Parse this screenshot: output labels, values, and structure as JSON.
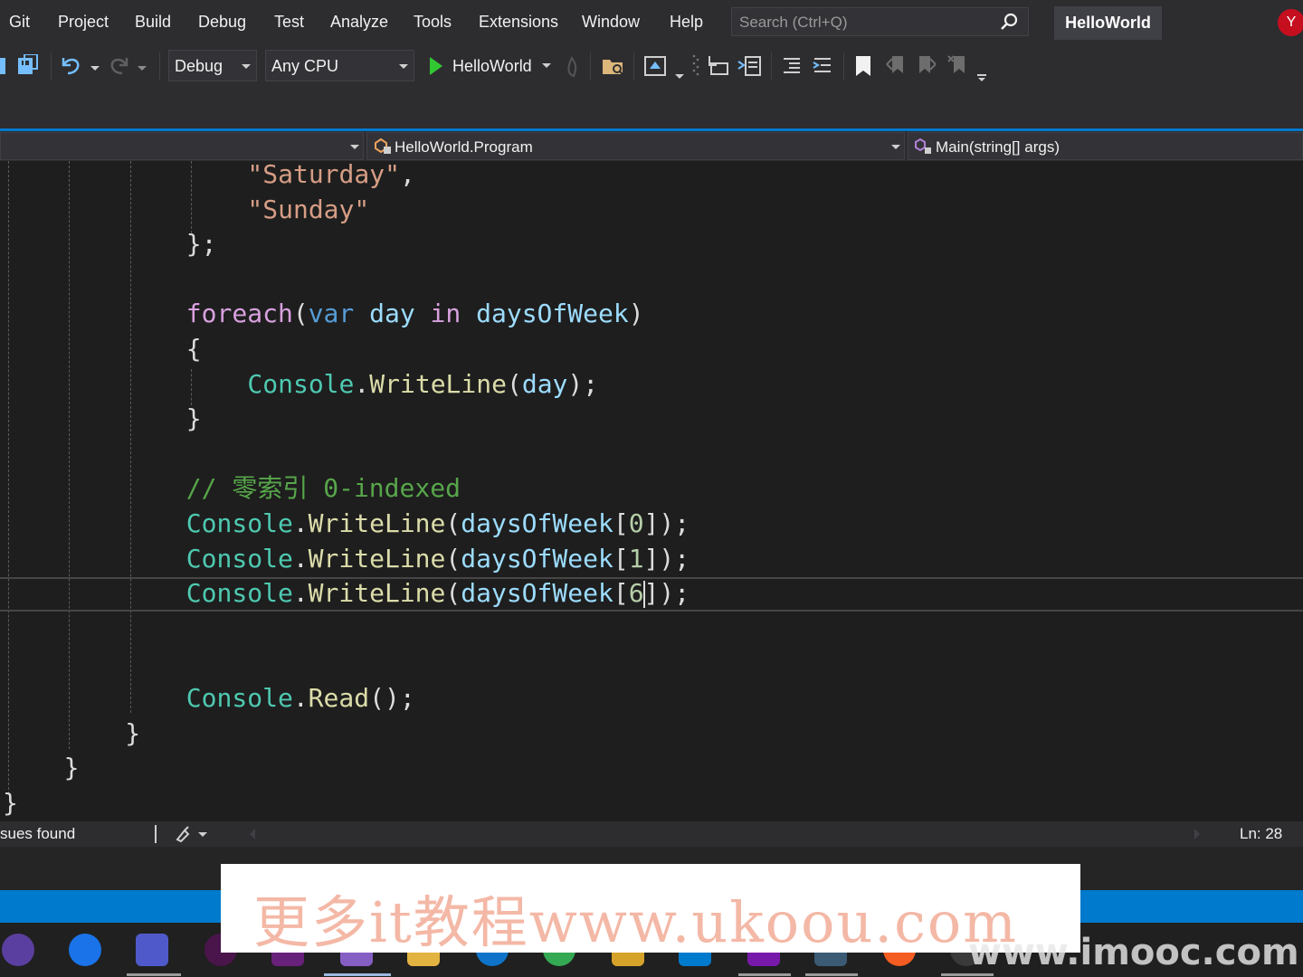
{
  "menu": {
    "items": [
      "Git",
      "Project",
      "Build",
      "Debug",
      "Test",
      "Analyze",
      "Tools",
      "Extensions",
      "Window",
      "Help"
    ],
    "search_placeholder": "Search (Ctrl+Q)",
    "solution_name": "HelloWorld",
    "avatar_initial": "Y"
  },
  "toolbar": {
    "configuration": "Debug",
    "platform": "Any CPU",
    "run_target": "HelloWorld"
  },
  "navbar": {
    "type_scope": "HelloWorld.Program",
    "member_scope": "Main(string[] args)"
  },
  "code": {
    "lines": [
      [
        {
          "t": "str",
          "v": "\"Saturday\""
        },
        {
          "t": "punc",
          "v": ","
        }
      ],
      [
        {
          "t": "str",
          "v": "\"Sunday\""
        }
      ],
      [
        {
          "t": "punc",
          "v": "};"
        }
      ],
      [],
      [
        {
          "t": "ctl",
          "v": "foreach"
        },
        {
          "t": "punc",
          "v": "("
        },
        {
          "t": "kw",
          "v": "var"
        },
        {
          "t": "punc",
          "v": " "
        },
        {
          "t": "var",
          "v": "day"
        },
        {
          "t": "punc",
          "v": " "
        },
        {
          "t": "ctl",
          "v": "in"
        },
        {
          "t": "punc",
          "v": " "
        },
        {
          "t": "var",
          "v": "daysOfWeek"
        },
        {
          "t": "punc",
          "v": ")"
        }
      ],
      [
        {
          "t": "punc",
          "v": "{"
        }
      ],
      [
        {
          "t": "type",
          "v": "Console"
        },
        {
          "t": "punc",
          "v": "."
        },
        {
          "t": "method",
          "v": "WriteLine"
        },
        {
          "t": "punc",
          "v": "("
        },
        {
          "t": "var",
          "v": "day"
        },
        {
          "t": "punc",
          "v": ");"
        }
      ],
      [
        {
          "t": "punc",
          "v": "}"
        }
      ],
      [],
      [
        {
          "t": "comment",
          "v": "// 零索引 0-indexed"
        }
      ],
      [
        {
          "t": "type",
          "v": "Console"
        },
        {
          "t": "punc",
          "v": "."
        },
        {
          "t": "method",
          "v": "WriteLine"
        },
        {
          "t": "punc",
          "v": "("
        },
        {
          "t": "var",
          "v": "daysOfWeek"
        },
        {
          "t": "punc",
          "v": "["
        },
        {
          "t": "num",
          "v": "0"
        },
        {
          "t": "punc",
          "v": "]);"
        }
      ],
      [
        {
          "t": "type",
          "v": "Console"
        },
        {
          "t": "punc",
          "v": "."
        },
        {
          "t": "method",
          "v": "WriteLine"
        },
        {
          "t": "punc",
          "v": "("
        },
        {
          "t": "var",
          "v": "daysOfWeek"
        },
        {
          "t": "punc",
          "v": "["
        },
        {
          "t": "num",
          "v": "1"
        },
        {
          "t": "punc",
          "v": "]);"
        }
      ],
      [
        {
          "t": "type",
          "v": "Console"
        },
        {
          "t": "punc",
          "v": "."
        },
        {
          "t": "method",
          "v": "WriteLine"
        },
        {
          "t": "punc",
          "v": "("
        },
        {
          "t": "var",
          "v": "daysOfWeek"
        },
        {
          "t": "punc",
          "v": "["
        },
        {
          "t": "num",
          "v": "6"
        },
        {
          "t": "caret",
          "v": ""
        },
        {
          "t": "punc",
          "v": "]);"
        }
      ],
      [],
      [],
      [
        {
          "t": "type",
          "v": "Console"
        },
        {
          "t": "punc",
          "v": "."
        },
        {
          "t": "method",
          "v": "Read"
        },
        {
          "t": "punc",
          "v": "();"
        }
      ],
      [
        {
          "t": "punc",
          "v": "}"
        }
      ],
      [
        {
          "t": "punc",
          "v": "}"
        }
      ],
      [
        {
          "t": "punc",
          "v": "}"
        }
      ]
    ],
    "indents": [
      8,
      8,
      6,
      0,
      6,
      6,
      8,
      6,
      0,
      6,
      6,
      6,
      6,
      0,
      0,
      6,
      4,
      2,
      0
    ],
    "current_line_index": 12
  },
  "status": {
    "issues_text": "sues found",
    "line_info": "Ln: 28"
  },
  "watermarks": {
    "banner": "更多it教程www.ukoou.com",
    "corner": "www.imooc.com"
  },
  "colors": {
    "accent": "#007acc",
    "string": "#d69d85",
    "keyword": "#569cd6",
    "control": "#d8a0df",
    "variable": "#9cdcfe",
    "type": "#4ec9b0",
    "method": "#dcdcaa",
    "comment": "#57a64a",
    "number": "#b5cea8"
  }
}
